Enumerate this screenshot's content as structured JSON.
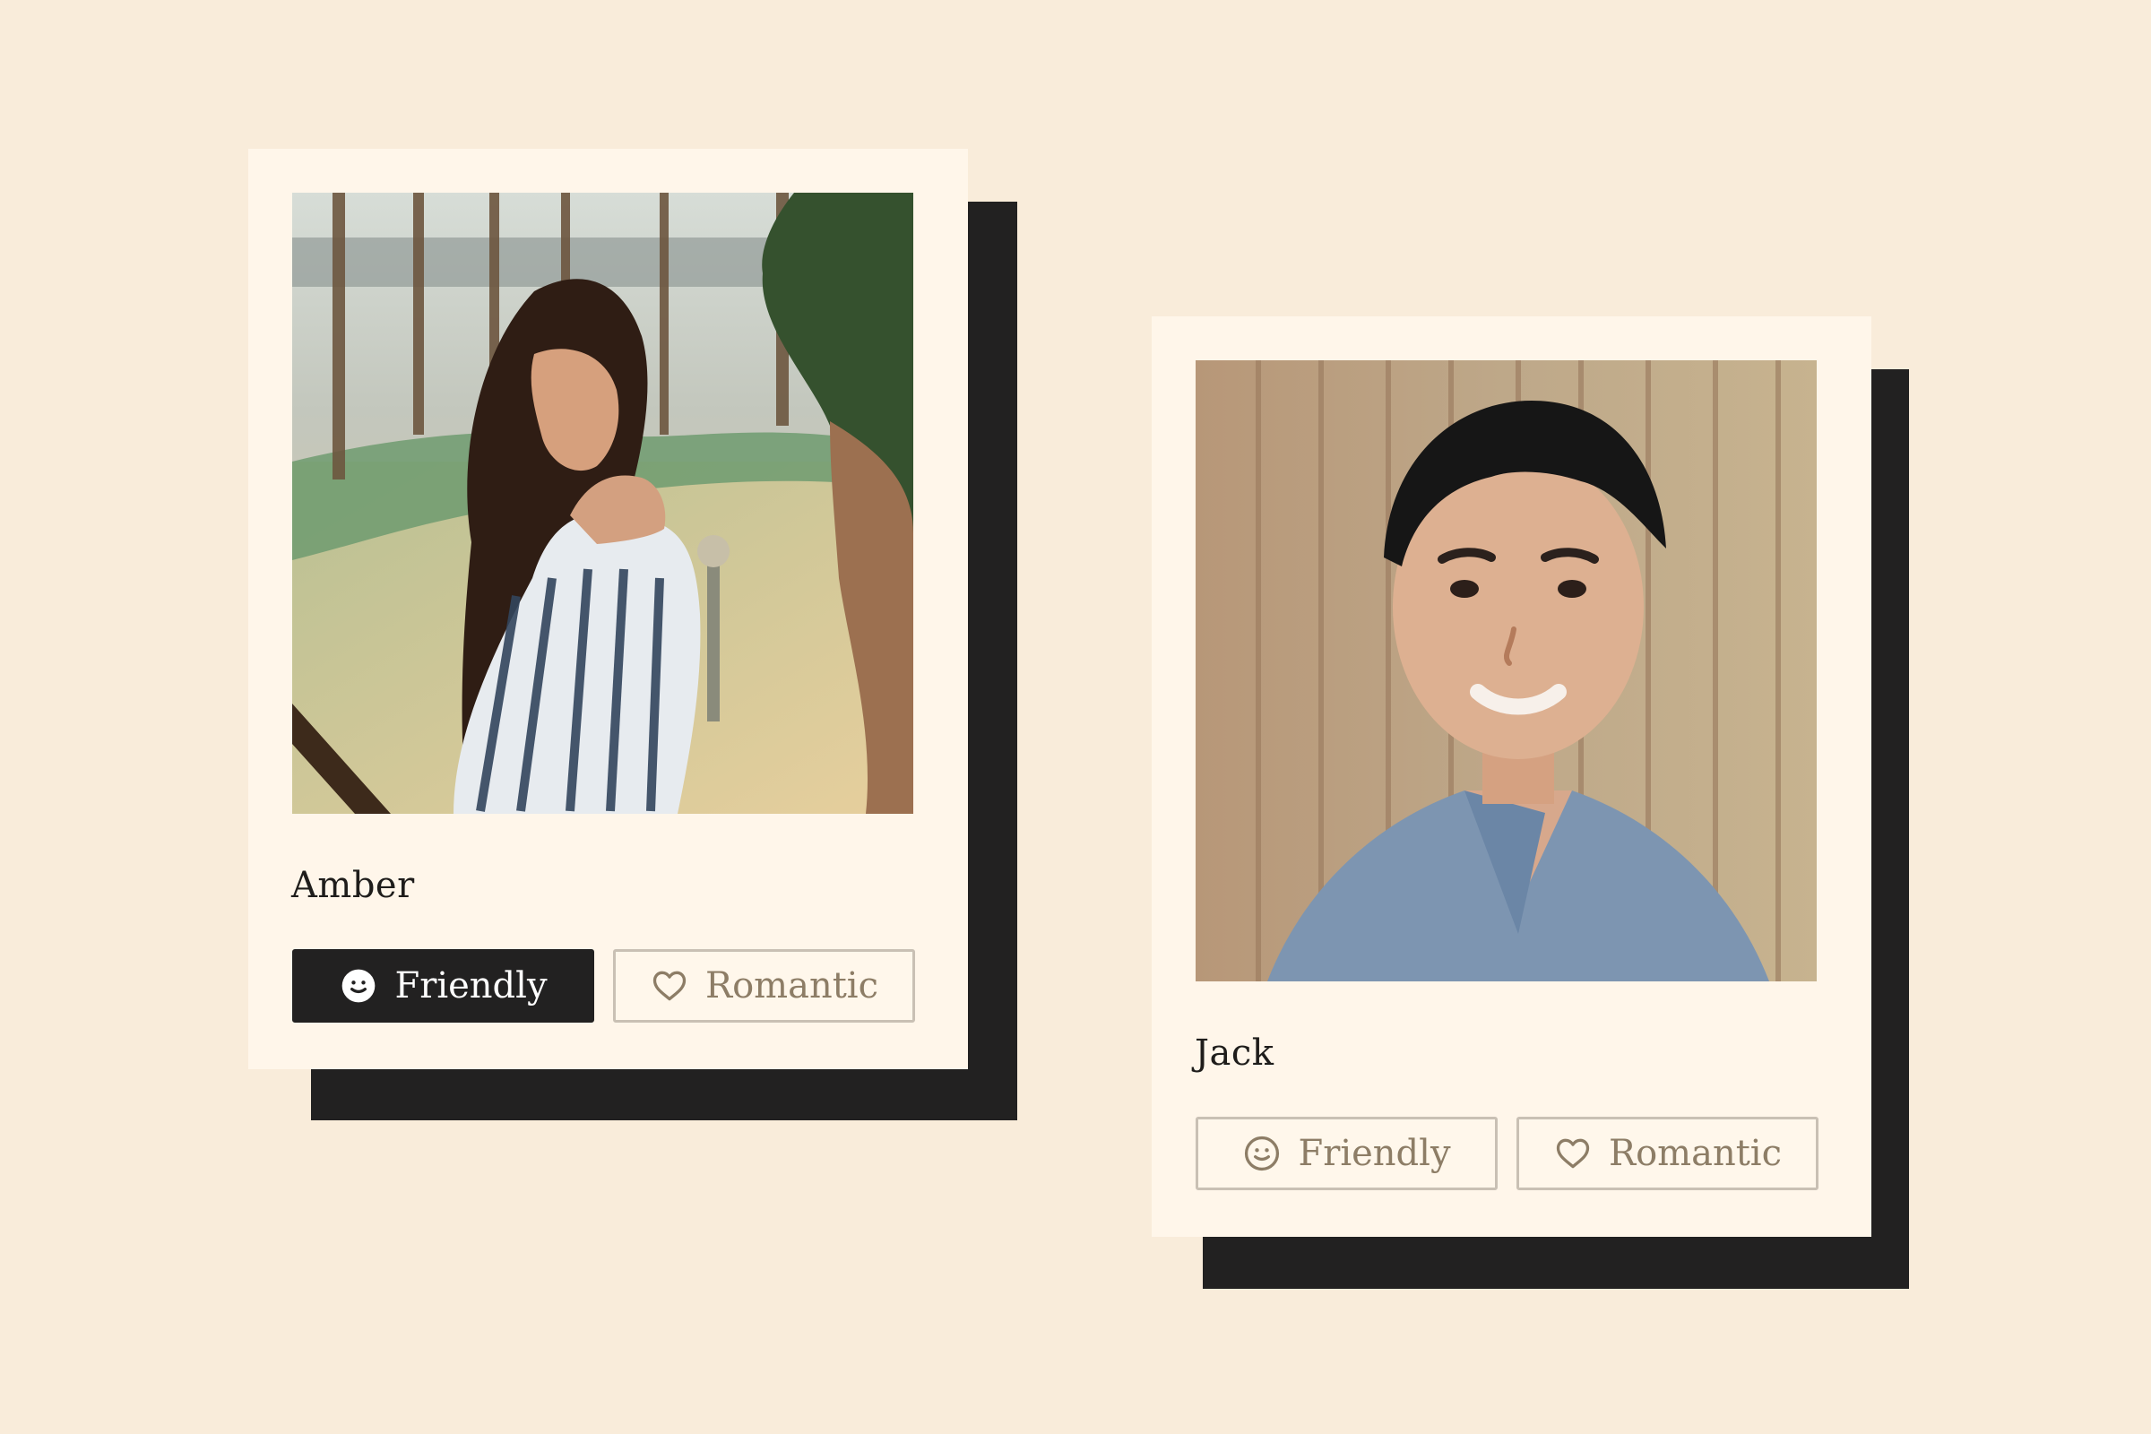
{
  "profiles": [
    {
      "name": "Amber",
      "buttons": {
        "friendly": "Friendly",
        "romantic": "Romantic"
      },
      "selected": "friendly"
    },
    {
      "name": "Jack",
      "buttons": {
        "friendly": "Friendly",
        "romantic": "Romantic"
      },
      "selected": "none"
    }
  ],
  "icons": {
    "friendly": "smiley-face-icon",
    "romantic": "heart-outline-icon"
  },
  "colors": {
    "background": "#f9ecda",
    "card": "#fff6ea",
    "shadow": "#222121",
    "button_text": "#8d7d66",
    "button_border": "#c9c0b4",
    "active_button": "#222121"
  }
}
